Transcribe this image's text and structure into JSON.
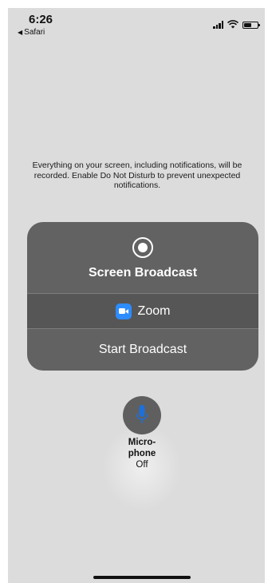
{
  "status_bar": {
    "time": "6:26",
    "back_app": "Safari",
    "icons": [
      "cellular-signal-icon",
      "wifi-icon",
      "battery-icon"
    ]
  },
  "info_text": "Everything on your screen, including notifications, will be recorded. Enable Do Not Disturb to prevent unexpected notifications.",
  "broadcast_panel": {
    "icon": "record-icon",
    "title": "Screen Broadcast",
    "app": {
      "icon": "zoom-app-icon",
      "name": "Zoom"
    },
    "action_label": "Start Broadcast"
  },
  "microphone": {
    "icon": "microphone-icon",
    "label_line1": "Micro-",
    "label_line2": "phone",
    "state": "Off"
  },
  "colors": {
    "background": "#dcdcdc",
    "panel": "#626262",
    "zoom_blue": "#2d8cff",
    "mic_blue": "#1e6fd9"
  }
}
